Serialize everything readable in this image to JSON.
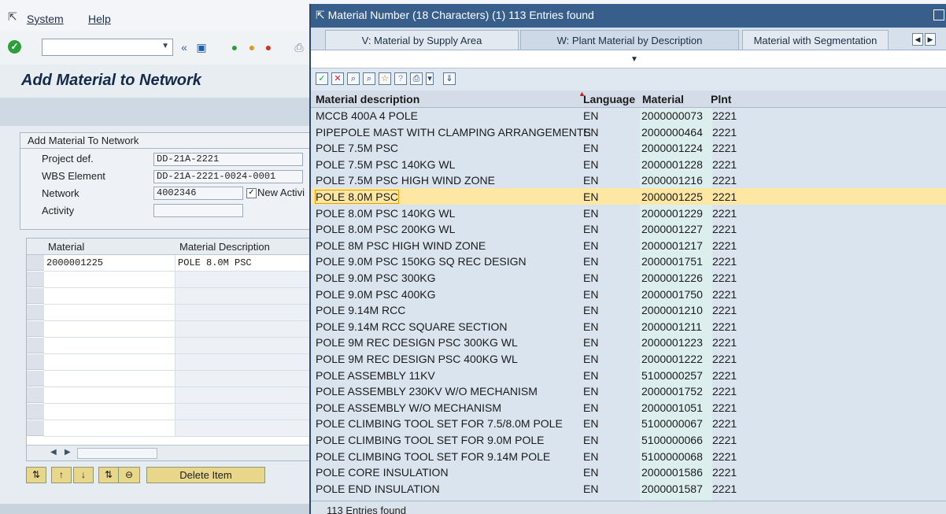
{
  "menubar": {
    "items": [
      "System",
      "Help"
    ]
  },
  "toolbar": {
    "command_value": ""
  },
  "page": {
    "title": "Add Material to Network"
  },
  "form": {
    "group_title": "Add Material To Network",
    "fields": [
      {
        "label": "Project def.",
        "value": "DD-21A-2221"
      },
      {
        "label": "WBS Element",
        "value": "DD-21A-2221-0024-0001"
      },
      {
        "label": "Network",
        "value": "4002346"
      },
      {
        "label": "Activity",
        "value": ""
      }
    ],
    "new_activity_label": "New Activi",
    "new_activity_checked": true
  },
  "items_table": {
    "columns": [
      "Material",
      "Material Description"
    ],
    "rows": [
      {
        "material": "2000001225",
        "description": "POLE 8.0M PSC"
      }
    ]
  },
  "buttons": {
    "delete_item": "Delete Item"
  },
  "popup": {
    "title": "Material Number (18 Characters) (1)  113 Entries found",
    "tabs": [
      "V: Material by Supply Area",
      "W: Plant Material by Description",
      "Material with Segmentation"
    ],
    "active_tab": 1,
    "columns": [
      "Material description",
      "Language",
      "Material",
      "Plnt"
    ],
    "rows": [
      {
        "desc": "MCCB 400A 4 POLE",
        "lang": "EN",
        "mat": "2000000073",
        "plnt": "2221"
      },
      {
        "desc": "PIPEPOLE MAST WITH CLAMPING ARRANGEMENTS",
        "lang": "EN",
        "mat": "2000000464",
        "plnt": "2221"
      },
      {
        "desc": "POLE 7.5M PSC",
        "lang": "EN",
        "mat": "2000001224",
        "plnt": "2221"
      },
      {
        "desc": "POLE 7.5M PSC 140KG WL",
        "lang": "EN",
        "mat": "2000001228",
        "plnt": "2221"
      },
      {
        "desc": "POLE 7.5M PSC HIGH WIND ZONE",
        "lang": "EN",
        "mat": "2000001216",
        "plnt": "2221"
      },
      {
        "desc": "POLE 8.0M PSC",
        "lang": "EN",
        "mat": "2000001225",
        "plnt": "2221",
        "selected": true
      },
      {
        "desc": "POLE 8.0M PSC 140KG WL",
        "lang": "EN",
        "mat": "2000001229",
        "plnt": "2221"
      },
      {
        "desc": "POLE 8.0M PSC 200KG WL",
        "lang": "EN",
        "mat": "2000001227",
        "plnt": "2221"
      },
      {
        "desc": "POLE 8M PSC HIGH WIND ZONE",
        "lang": "EN",
        "mat": "2000001217",
        "plnt": "2221"
      },
      {
        "desc": "POLE 9.0M PSC 150KG SQ REC DESIGN",
        "lang": "EN",
        "mat": "2000001751",
        "plnt": "2221"
      },
      {
        "desc": "POLE 9.0M PSC 300KG",
        "lang": "EN",
        "mat": "2000001226",
        "plnt": "2221"
      },
      {
        "desc": "POLE 9.0M PSC 400KG",
        "lang": "EN",
        "mat": "2000001750",
        "plnt": "2221"
      },
      {
        "desc": "POLE 9.14M RCC",
        "lang": "EN",
        "mat": "2000001210",
        "plnt": "2221"
      },
      {
        "desc": "POLE 9.14M RCC SQUARE SECTION",
        "lang": "EN",
        "mat": "2000001211",
        "plnt": "2221"
      },
      {
        "desc": "POLE 9M REC DESIGN PSC 300KG WL",
        "lang": "EN",
        "mat": "2000001223",
        "plnt": "2221"
      },
      {
        "desc": "POLE 9M REC DESIGN PSC 400KG WL",
        "lang": "EN",
        "mat": "2000001222",
        "plnt": "2221"
      },
      {
        "desc": "POLE ASSEMBLY 11KV",
        "lang": "EN",
        "mat": "5100000257",
        "plnt": "2221"
      },
      {
        "desc": "POLE ASSEMBLY 230KV W/O MECHANISM",
        "lang": "EN",
        "mat": "2000001752",
        "plnt": "2221"
      },
      {
        "desc": "POLE ASSEMBLY W/O MECHANISM",
        "lang": "EN",
        "mat": "2000001051",
        "plnt": "2221"
      },
      {
        "desc": "POLE CLIMBING TOOL SET FOR 7.5/8.0M POLE",
        "lang": "EN",
        "mat": "5100000067",
        "plnt": "2221"
      },
      {
        "desc": "POLE CLIMBING TOOL SET FOR 9.0M POLE",
        "lang": "EN",
        "mat": "5100000066",
        "plnt": "2221"
      },
      {
        "desc": "POLE CLIMBING TOOL SET FOR 9.14M POLE",
        "lang": "EN",
        "mat": "5100000068",
        "plnt": "2221"
      },
      {
        "desc": "POLE CORE INSULATION",
        "lang": "EN",
        "mat": "2000001586",
        "plnt": "2221"
      },
      {
        "desc": "POLE END INSULATION",
        "lang": "EN",
        "mat": "2000001587",
        "plnt": "2221"
      }
    ],
    "footer": "113 Entries found"
  },
  "colors": {
    "popup_title_bg": "#385f8c",
    "selected_row": "#fde7a3",
    "material_column": "#dcefee"
  }
}
